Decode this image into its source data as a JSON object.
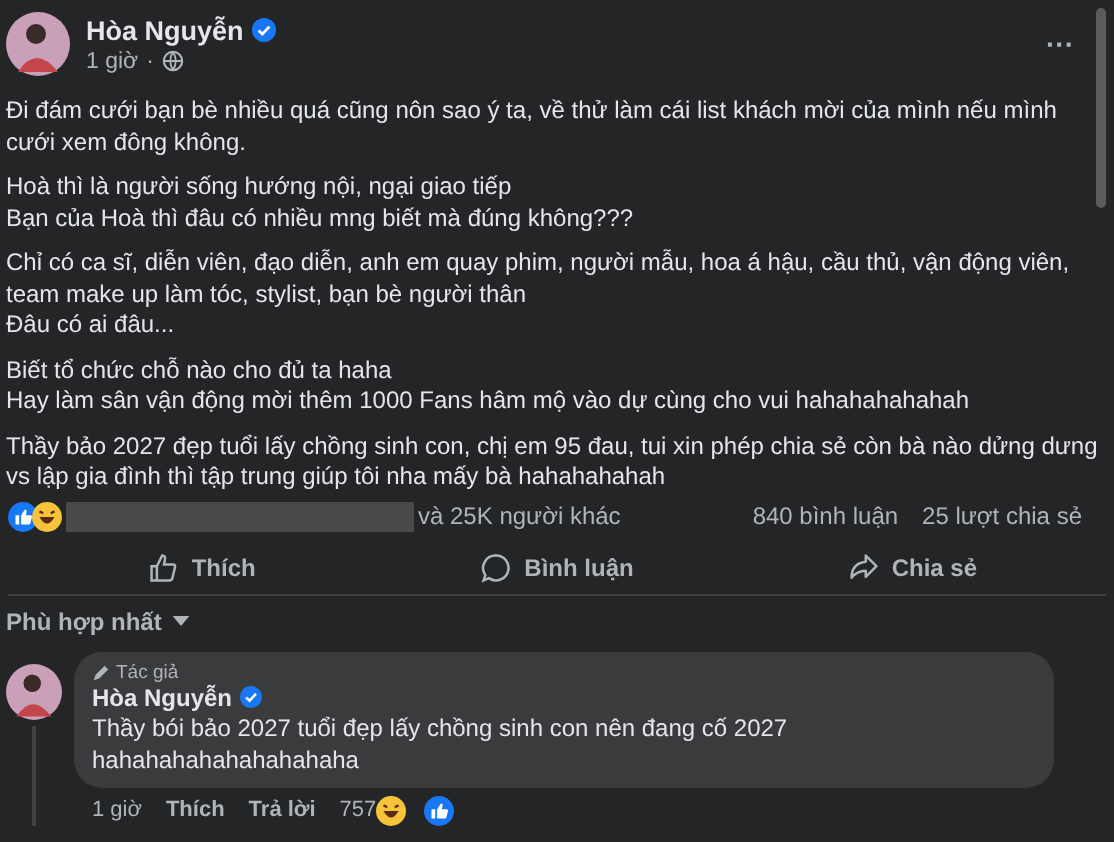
{
  "post": {
    "author": "Hòa Nguyễn",
    "verified": true,
    "time": "1 giờ",
    "separator": "·",
    "more": "···",
    "paragraphs": [
      [
        "Đi đám cưới bạn bè nhiều quá cũng nôn sao ý ta, về thử làm cái list khách mời của mình nếu mình",
        "cưới xem đông không."
      ],
      [
        "Hoà thì là người sống hướng nội, ngại giao tiếp",
        "Bạn của Hoà thì đâu có nhiều mng biết mà đúng không???"
      ],
      [
        "Chỉ có ca sĩ, diễn viên, đạo diễn, anh em quay phim, người mẫu, hoa á hậu, cầu thủ, vận động viên,",
        "team make up làm tóc, stylist, bạn bè người thân",
        "Đâu có ai đâu..."
      ],
      [
        "Biết tổ chức chỗ nào cho đủ ta haha",
        "Hay làm sân vận động mời thêm 1000 Fans hâm mộ vào dự cùng cho vui hahahahahahah"
      ],
      [
        "Thầy bảo 2027 đẹp tuổi lấy chồng sinh con, chị em 95 đau, tui xin phép chia sẻ còn bà nào dửng dưng",
        "vs lập gia đình thì tập trung giúp tôi nha mấy bà hahahahahah"
      ]
    ],
    "reactions_summary": "và 25K người khác",
    "comments_count": "840 bình luận",
    "shares_count": "25 lượt chia sẻ",
    "actions": [
      {
        "kind": "like",
        "label": "Thích"
      },
      {
        "kind": "comment",
        "label": "Bình luận"
      },
      {
        "kind": "share",
        "label": "Chia sẻ"
      }
    ]
  },
  "sort": {
    "label": "Phù hợp nhất"
  },
  "comment": {
    "badge": "Tác giả",
    "author": "Hòa Nguyễn",
    "verified": true,
    "lines": [
      "Thầy bói bảo 2027 tuổi đẹp lấy chồng sinh con nên đang cố 2027",
      "hahahahahahahahahaha"
    ],
    "time": "1 giờ",
    "like": "Thích",
    "reply": "Trả lời",
    "reaction_count": "757"
  }
}
